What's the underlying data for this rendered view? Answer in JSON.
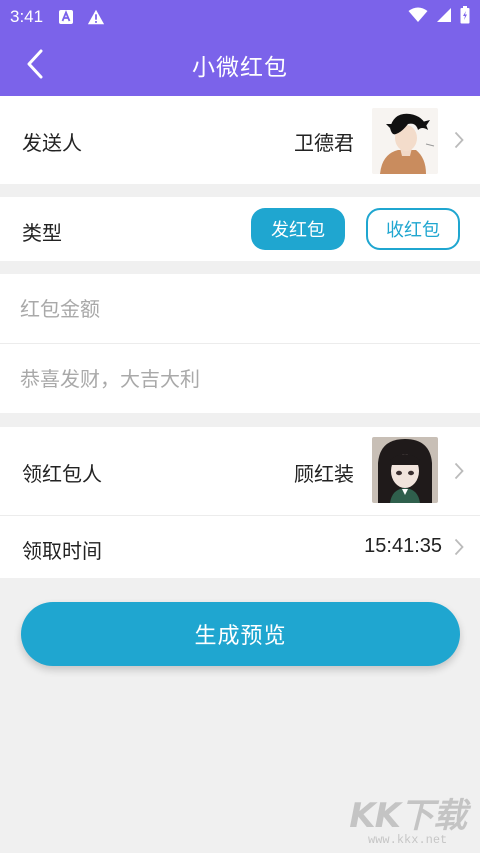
{
  "status_bar": {
    "time": "3:41",
    "icons": [
      "notification-a-icon",
      "warning-icon",
      "wifi-icon",
      "signal-icon",
      "battery-icon"
    ]
  },
  "header": {
    "title": "小微红包",
    "back_icon": "chevron-left-icon",
    "color": "#7b63ea"
  },
  "sender": {
    "label": "发送人",
    "name": "卫德君",
    "avatar": "sender-avatar"
  },
  "type": {
    "label": "类型",
    "options": [
      "发红包",
      "收红包"
    ],
    "selected": "发红包"
  },
  "amount_input": {
    "placeholder": "红包金额",
    "value": ""
  },
  "message_input": {
    "placeholder": "恭喜发财，大吉大利",
    "value": ""
  },
  "receiver": {
    "label": "领红包人",
    "name": "顾红装",
    "avatar": "receiver-avatar"
  },
  "receive_time": {
    "label": "领取时间",
    "value": "15:41:35"
  },
  "generate_button": {
    "label": "生成预览",
    "color": "#1fa6d0"
  },
  "watermark": {
    "logo": "KK下载",
    "url": "www.kkx.net"
  }
}
